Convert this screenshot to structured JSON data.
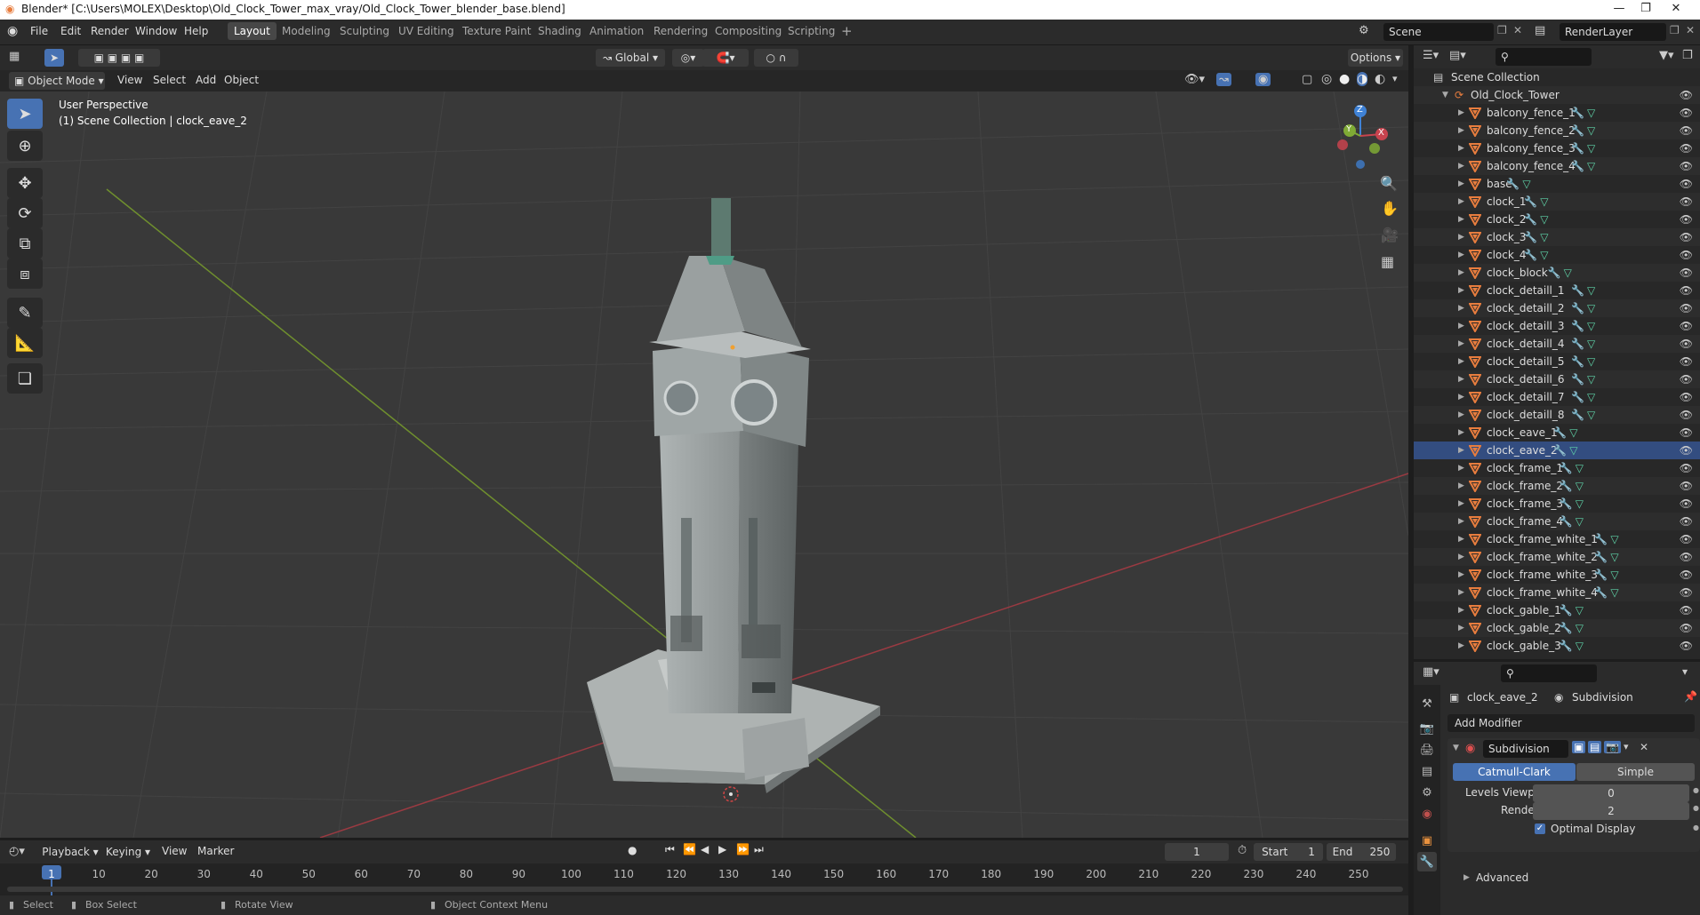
{
  "window": {
    "title": "Blender* [C:\\Users\\MOLEX\\Desktop\\Old_Clock_Tower_max_vray/Old_Clock_Tower_blender_base.blend]"
  },
  "menu": [
    "File",
    "Edit",
    "Render",
    "Window",
    "Help"
  ],
  "workspaces": [
    "Layout",
    "Modeling",
    "Sculpting",
    "UV Editing",
    "Texture Paint",
    "Shading",
    "Animation",
    "Rendering",
    "Compositing",
    "Scripting"
  ],
  "active_workspace": "Layout",
  "scene": {
    "name": "Scene",
    "render_layer": "RenderLayer"
  },
  "tool_header": {
    "orientation": "Global",
    "options": "Options"
  },
  "viewport_header": {
    "mode": "Object Mode",
    "menus": [
      "View",
      "Select",
      "Add",
      "Object"
    ]
  },
  "viewport": {
    "perspective": "User Perspective",
    "collection_info": "(1) Scene Collection | clock_eave_2",
    "gizmo": {
      "x": "X",
      "y": "Y",
      "z": "Z"
    }
  },
  "outliner": {
    "root": "Scene Collection",
    "collection": "Old_Clock_Tower",
    "selected": "clock_eave_2",
    "items": [
      "balcony_fence_1",
      "balcony_fence_2",
      "balcony_fence_3",
      "balcony_fence_4",
      "base",
      "clock_1",
      "clock_2",
      "clock_3",
      "clock_4",
      "clock_block",
      "clock_detaill_1",
      "clock_detaill_2",
      "clock_detaill_3",
      "clock_detaill_4",
      "clock_detaill_5",
      "clock_detaill_6",
      "clock_detaill_7",
      "clock_detaill_8",
      "clock_eave_1",
      "clock_eave_2",
      "clock_frame_1",
      "clock_frame_2",
      "clock_frame_3",
      "clock_frame_4",
      "clock_frame_white_1",
      "clock_frame_white_2",
      "clock_frame_white_3",
      "clock_frame_white_4",
      "clock_gable_1",
      "clock_gable_2",
      "clock_gable_3"
    ]
  },
  "properties": {
    "object": "clock_eave_2",
    "modifier_tab": "Subdivision",
    "add_modifier": "Add Modifier",
    "modifier": {
      "name": "Subdivision",
      "type_a": "Catmull-Clark",
      "type_b": "Simple",
      "levels_viewport_label": "Levels Viewport",
      "levels_viewport": "0",
      "render_label": "Render",
      "render": "2",
      "optimal_display": "Optimal Display",
      "advanced": "Advanced"
    }
  },
  "timeline": {
    "menus": [
      "Playback",
      "Keying",
      "View",
      "Marker"
    ],
    "current_frame": "1",
    "start_label": "Start",
    "start": "1",
    "end_label": "End",
    "end": "250",
    "ticks": [
      "1",
      "10",
      "20",
      "30",
      "40",
      "50",
      "60",
      "70",
      "80",
      "90",
      "100",
      "110",
      "120",
      "130",
      "140",
      "150",
      "160",
      "170",
      "180",
      "190",
      "200",
      "210",
      "220",
      "230",
      "240",
      "250"
    ]
  },
  "statusbar": [
    "Select",
    "Box Select",
    "Rotate View",
    "Object Context Menu"
  ],
  "colors": {
    "accent": "#4772b3",
    "selected_row": "#334d80",
    "mesh_icon": "#e87d3e",
    "x_axis": "#c8434e",
    "y_axis": "#7faa35",
    "z_axis": "#3f82d6"
  }
}
